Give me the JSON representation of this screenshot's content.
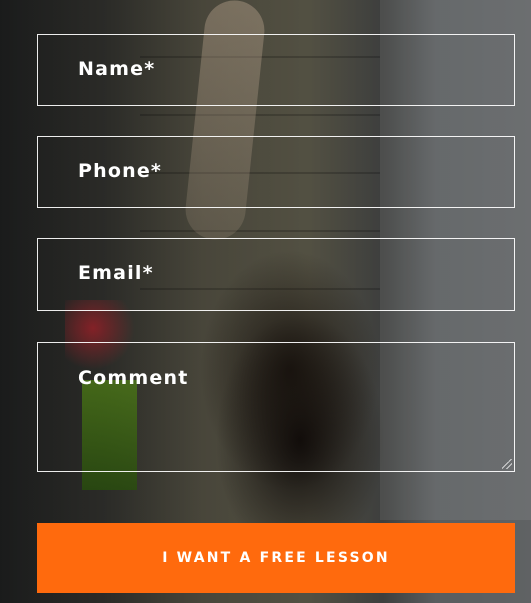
{
  "form": {
    "fields": {
      "name": {
        "placeholder": "Name*"
      },
      "phone": {
        "placeholder": "Phone*"
      },
      "email": {
        "placeholder": "Email*"
      },
      "comment": {
        "placeholder": "Comment"
      }
    },
    "submit_label": "I WANT A FREE LESSON"
  },
  "colors": {
    "accent": "#ff6a0d",
    "field_border": "#ffffff",
    "text": "#ffffff"
  }
}
